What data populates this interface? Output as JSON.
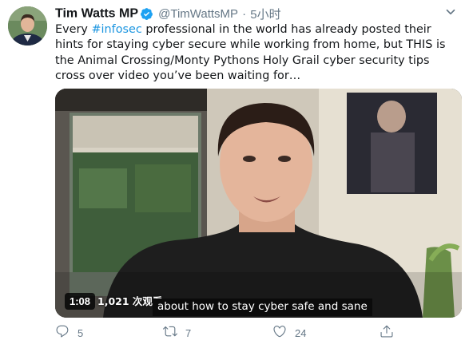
{
  "author": {
    "name": "Tim Watts MP",
    "handle": "@TimWattsMP",
    "separator": "·",
    "time": "5小时"
  },
  "tweet": {
    "text_before_hashtag": "Every ",
    "hashtag": "#infosec",
    "text_after_hashtag": " professional in the world has already posted their hints for staying cyber secure while working from home, but THIS is the Animal Crossing/Monty Pythons Holy Grail cyber security tips cross over video you’ve been waiting for…"
  },
  "video": {
    "duration": "1:08",
    "views": "1,021 次观看",
    "caption": "about how to stay cyber safe and sane"
  },
  "actions": {
    "reply_count": "5",
    "retweet_count": "7",
    "like_count": "24"
  },
  "icons": {
    "verified": "verified-badge-icon",
    "more": "chevron-down-icon",
    "reply": "reply-icon",
    "retweet": "retweet-icon",
    "like": "heart-icon",
    "share": "share-icon"
  },
  "colors": {
    "link": "#1b95e0",
    "secondary_text": "#657786",
    "primary_text": "#14171a",
    "verified": "#1da1f2"
  }
}
